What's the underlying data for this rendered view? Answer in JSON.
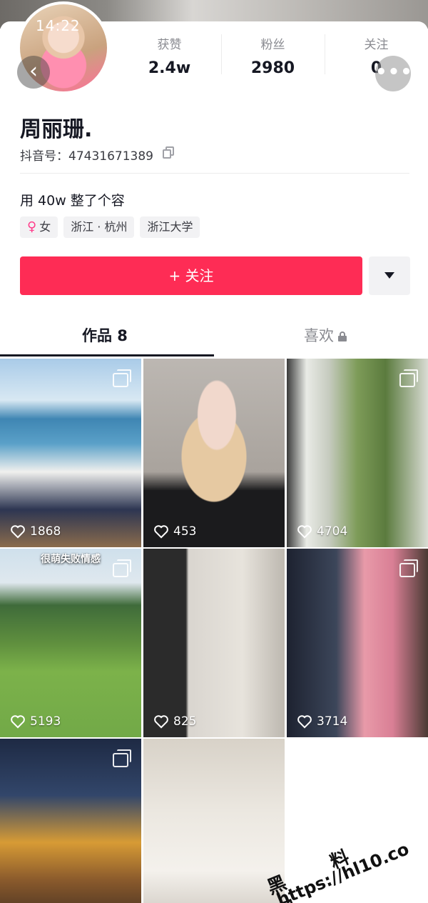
{
  "status_bar": {
    "time": "14:22"
  },
  "profile": {
    "name": "周丽珊.",
    "douyin_id": "抖音号：47431671389",
    "bio": "用 40w 整了个容",
    "tags": [
      {
        "label": "女",
        "icon": "female-icon"
      },
      {
        "label": "浙江 · 杭州"
      },
      {
        "label": "浙江大学"
      }
    ]
  },
  "stats": [
    {
      "label": "获赞",
      "value": "2.4w"
    },
    {
      "label": "粉丝",
      "value": "2980"
    },
    {
      "label": "关注",
      "value": "0"
    }
  ],
  "actions": {
    "follow_label": "+ 关注",
    "back_icon": "chevron-left-icon",
    "more_icon": "more-icon"
  },
  "tabs": [
    {
      "label": "作品 8",
      "active": true
    },
    {
      "label": "喜欢",
      "locked": true
    }
  ],
  "videos": [
    {
      "likes": "1868",
      "multi": true
    },
    {
      "likes": "453",
      "multi": false
    },
    {
      "likes": "4704",
      "multi": true
    },
    {
      "likes": "5193",
      "multi": true,
      "caption": "很萌失败情感"
    },
    {
      "likes": "825",
      "multi": false
    },
    {
      "likes": "3714",
      "multi": true
    },
    {
      "likes": "",
      "multi": true
    },
    {
      "likes": "",
      "multi": false
    }
  ],
  "watermark": {
    "title": "黑 料 网",
    "url": "https://hl10.co"
  },
  "colors": {
    "accent": "#fe2c55",
    "text": "#161823",
    "muted": "#8a8b91"
  }
}
